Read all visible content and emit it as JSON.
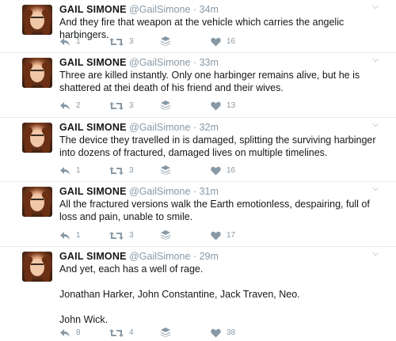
{
  "tweets": [
    {
      "name": "GAIL SIMONE",
      "handle": "@GailSimone",
      "separator": "·",
      "time": "34m",
      "lines": [
        "And they fire that weapon at the vehicle which carries the angelic harbingers."
      ],
      "replies": "1",
      "retweets": "3",
      "likes": "16"
    },
    {
      "name": "GAIL SIMONE",
      "handle": "@GailSimone",
      "separator": "·",
      "time": "33m",
      "lines": [
        "Three are killed instantly. Only one harbinger remains alive, but he is shattered at thei death of his friend and their wives."
      ],
      "replies": "2",
      "retweets": "3",
      "likes": "13"
    },
    {
      "name": "GAIL SIMONE",
      "handle": "@GailSimone",
      "separator": "·",
      "time": "32m",
      "lines": [
        "The device they travelled in is damaged, splitting the surviving harbinger into dozens of fractured, damaged lives on multiple timelines."
      ],
      "replies": "1",
      "retweets": "3",
      "likes": "16"
    },
    {
      "name": "GAIL SIMONE",
      "handle": "@GailSimone",
      "separator": "·",
      "time": "31m",
      "lines": [
        "All the fractured versions walk the Earth emotionless, despairing, full of loss and pain, unable to smile."
      ],
      "replies": "1",
      "retweets": "3",
      "likes": "17"
    },
    {
      "name": "GAIL SIMONE",
      "handle": "@GailSimone",
      "separator": "·",
      "time": "29m",
      "lines": [
        "And yet, each has a well of rage.",
        "Jonathan Harker, John Constantine, Jack Traven, Neo.",
        "John Wick."
      ],
      "replies": "8",
      "retweets": "4",
      "likes": "38"
    }
  ],
  "icons": {
    "reply": "reply-icon",
    "retweet": "retweet-icon",
    "buffer": "buffer-stack-icon",
    "like": "heart-icon",
    "more": "chevron-down-icon"
  },
  "colors": {
    "icon_gray": "#8899a6",
    "text": "#14171a",
    "divider": "#e6ecf0"
  }
}
